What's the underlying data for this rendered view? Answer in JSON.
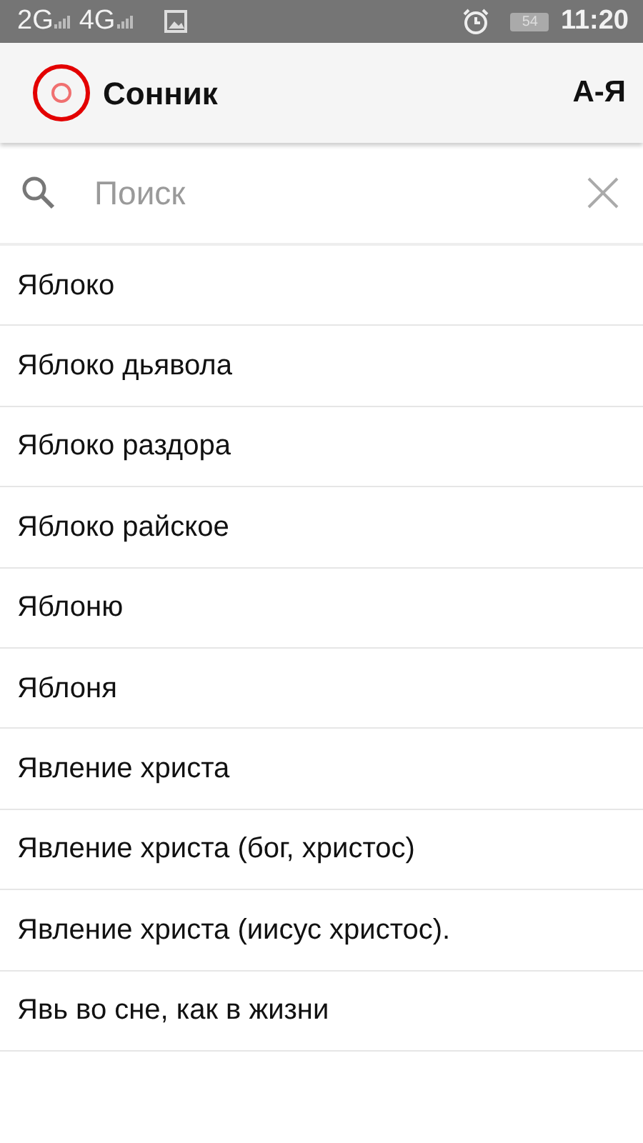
{
  "status_bar": {
    "network_1": "2G",
    "network_2": "4G",
    "battery": "54",
    "time": "11:20"
  },
  "app_bar": {
    "title": "Сонник",
    "sort": "А-Я"
  },
  "search": {
    "placeholder": "Поиск"
  },
  "items": [
    "Яблоко",
    "Яблоко дьявола",
    "Яблоко раздора",
    "Яблоко райское",
    "Яблоню",
    "Яблоня",
    "Явление христа",
    "Явление христа (бог, христос)",
    "Явление христа (иисус христос).",
    "Явь во сне, как в жизни"
  ]
}
